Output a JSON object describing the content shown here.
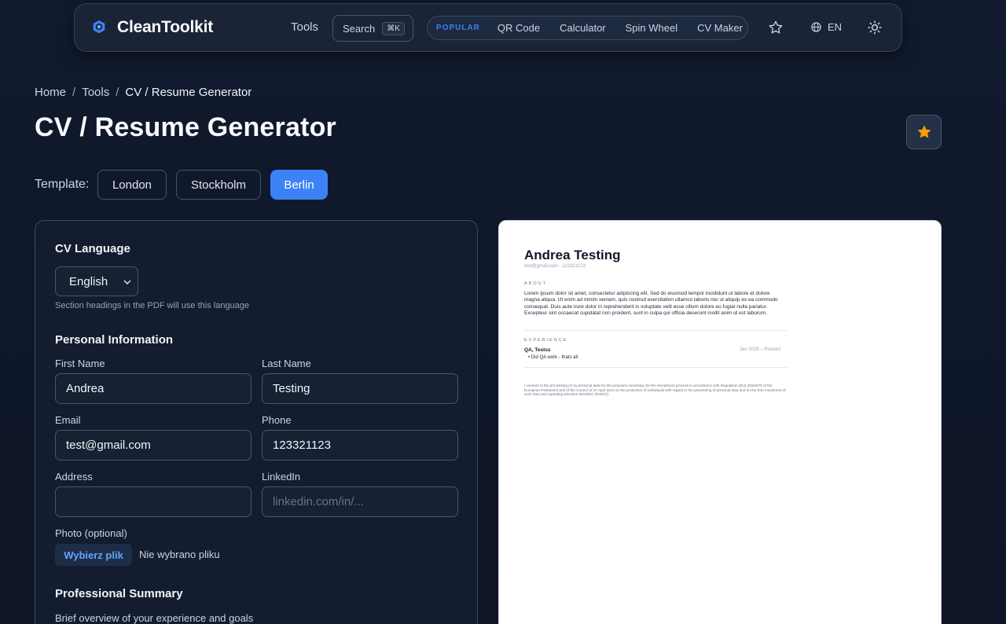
{
  "header": {
    "brand": "CleanToolkit",
    "nav_tools": "Tools",
    "search_label": "Search",
    "search_shortcut": "⌘K",
    "popular_tag": "POPULAR",
    "popular_links": [
      "QR Code",
      "Calculator",
      "Spin Wheel",
      "CV Maker"
    ],
    "language": "EN"
  },
  "breadcrumb": {
    "home": "Home",
    "tools": "Tools",
    "current": "CV / Resume Generator"
  },
  "page_title": "CV / Resume Generator",
  "template": {
    "label": "Template:",
    "options": [
      "London",
      "Stockholm",
      "Berlin"
    ],
    "selected": "Berlin"
  },
  "form": {
    "cv_language": {
      "title": "CV Language",
      "value": "English",
      "hint": "Section headings in the PDF will use this language"
    },
    "personal": {
      "title": "Personal Information",
      "first_name_label": "First Name",
      "first_name": "Andrea",
      "last_name_label": "Last Name",
      "last_name": "Testing",
      "email_label": "Email",
      "email": "test@gmail.com",
      "phone_label": "Phone",
      "phone": "123321123",
      "address_label": "Address",
      "address": "",
      "linkedin_label": "LinkedIn",
      "linkedin_placeholder": "linkedin.com/in/...",
      "photo_label": "Photo (optional)",
      "photo_button": "Wybierz plik",
      "photo_status": "Nie wybrano pliku"
    },
    "summary": {
      "title": "Professional Summary",
      "hint": "Brief overview of your experience and goals"
    }
  },
  "preview": {
    "name": "Andrea Testing",
    "contact": "test@gmail.com · 123321123",
    "about_heading": "ABOUT",
    "about_text": "Lorem ipsum dolor sit amet, consectetur adipiscing elit. Sed do eiusmod tempor incididunt ut labore et dolore magna aliqua. Ut enim ad minim veniam, quis nostrud exercitation ullamco laboris nisi ut aliquip ex ea commodo consequat. Duis aute irure dolor in reprehenderit in voluptate velit esse cillum dolore eu fugiat nulla pariatur. Excepteur sint occaecat cupidatat non proident, sunt in culpa qui officia deserunt mollit anim id est laborum.",
    "experience_heading": "EXPERIENCE",
    "role": "QA, Testss",
    "dates": "Jan 2026 – Present",
    "bullet": "Did QA work - thats all",
    "consent": "I consent to the processing of my personal data for the purposes necessary for the recruitment process in accordance with Regulation (EU) 2016/679 of the European Parliament and of the Council of 27 April 2016 on the protection of individuals with regard to the processing of personal data and on the free movement of such data and repealing Directive 95/46/EC (RODO)."
  },
  "colors": {
    "accent": "#3b82f6",
    "background": "#0f172a",
    "star": "#f59e0b"
  },
  "icons": [
    "logo-icon",
    "star-outline-icon",
    "globe-icon",
    "sun-icon",
    "star-filled-icon",
    "chevron-down-icon"
  ]
}
